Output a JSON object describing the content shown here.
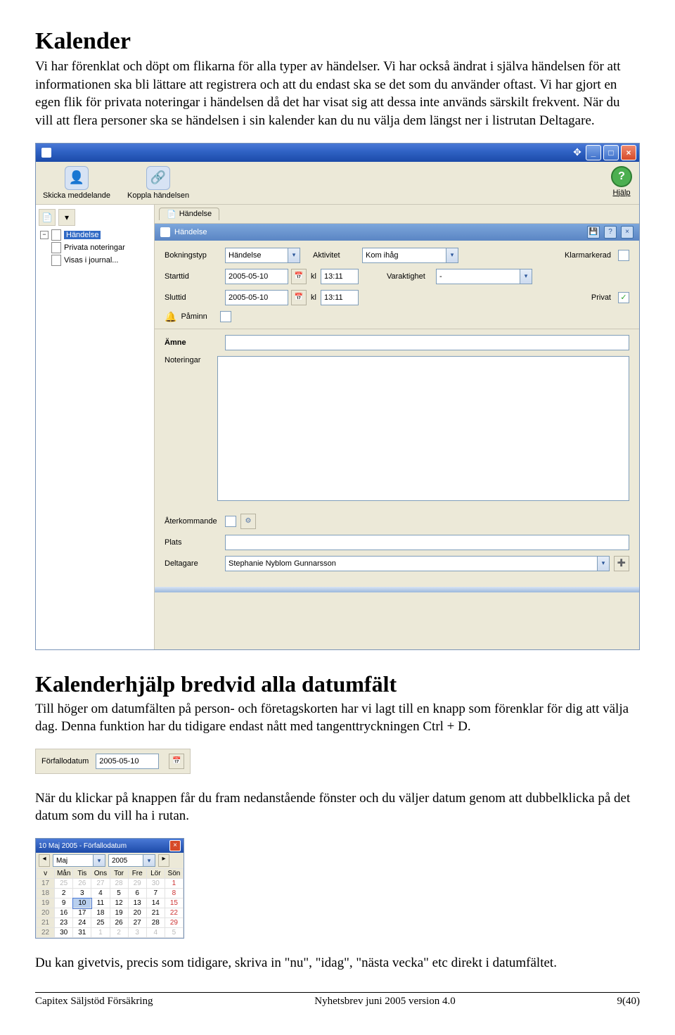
{
  "heading1": "Kalender",
  "para1": "Vi har förenklat och döpt om flikarna för alla typer av händelser. Vi har också ändrat i själva händelsen för att informationen ska bli lättare att registrera och att du endast ska se det som du använder oftast. Vi har gjort en egen flik för privata noteringar i händelsen då det har visat sig att dessa inte används särskilt frekvent. När du vill att flera personer ska se händelsen i sin kalender kan du nu välja dem längst ner i listrutan Deltagare.",
  "window": {
    "toolbar": {
      "send_msg": "Skicka meddelande",
      "link_event": "Koppla händelsen",
      "help": "Hjälp"
    },
    "tree": {
      "items": [
        "Händelse",
        "Privata noteringar",
        "Visas i journal..."
      ]
    },
    "tab": "Händelse",
    "panel_title": "Händelse",
    "form": {
      "bokningstyp_label": "Bokningstyp",
      "bokningstyp_value": "Händelse",
      "aktivitet_label": "Aktivitet",
      "aktivitet_value": "Kom ihåg",
      "klarmarkerad_label": "Klarmarkerad",
      "klarmarkerad_checked": false,
      "starttid_label": "Starttid",
      "starttid_date": "2005-05-10",
      "starttid_kl": "kl",
      "starttid_time": "13:11",
      "varaktighet_label": "Varaktighet",
      "varaktighet_value": "-",
      "sluttid_label": "Sluttid",
      "sluttid_date": "2005-05-10",
      "sluttid_kl": "kl",
      "sluttid_time": "13:11",
      "privat_label": "Privat",
      "privat_checked": true,
      "paminn_label": "Påminn",
      "paminn_checked": false,
      "amne_label": "Ämne",
      "amne_value": "",
      "noteringar_label": "Noteringar",
      "noteringar_value": "",
      "aterkommande_label": "Återkommande",
      "aterkommande_checked": false,
      "plats_label": "Plats",
      "plats_value": "",
      "deltagare_label": "Deltagare",
      "deltagare_value": "Stephanie Nyblom Gunnarsson"
    }
  },
  "heading2": "Kalenderhjälp bredvid alla datumfält",
  "para2": "Till höger om datumfälten på person- och företagskorten har vi lagt till en knapp som förenklar för dig att välja dag. Denna funktion har du tidigare endast nått med tangenttryckningen Ctrl + D.",
  "inline_form": {
    "label": "Förfallodatum",
    "value": "2005-05-10"
  },
  "para3": "När du klickar på knappen får du fram nedanstående fönster och du väljer datum genom att dubbelklicka på det datum som du vill ha i rutan.",
  "cal": {
    "title": "10 Maj 2005 - Förfallodatum",
    "month": "Maj",
    "year": "2005",
    "dow": [
      "Mån",
      "Tis",
      "Ons",
      "Tor",
      "Fre",
      "Lör",
      "Sön"
    ],
    "weeks": [
      {
        "wk": "17",
        "d": [
          "25",
          "26",
          "27",
          "28",
          "29",
          "30",
          "1"
        ],
        "other": [
          0,
          1,
          2,
          3,
          4,
          5
        ],
        "sun": 6
      },
      {
        "wk": "18",
        "d": [
          "2",
          "3",
          "4",
          "5",
          "6",
          "7",
          "8"
        ],
        "sun": 6
      },
      {
        "wk": "19",
        "d": [
          "9",
          "10",
          "11",
          "12",
          "13",
          "14",
          "15"
        ],
        "today": 1,
        "sun": 6
      },
      {
        "wk": "20",
        "d": [
          "16",
          "17",
          "18",
          "19",
          "20",
          "21",
          "22"
        ],
        "sun": 6
      },
      {
        "wk": "21",
        "d": [
          "23",
          "24",
          "25",
          "26",
          "27",
          "28",
          "29"
        ],
        "sun": 6
      },
      {
        "wk": "22",
        "d": [
          "30",
          "31",
          "1",
          "2",
          "3",
          "4",
          "5"
        ],
        "other": [
          2,
          3,
          4,
          5,
          6
        ],
        "sun": 6
      }
    ]
  },
  "para4": "Du kan givetvis, precis som tidigare, skriva in \"nu\", \"idag\", \"nästa vecka\" etc direkt i datumfältet.",
  "footer": {
    "left": "Capitex Säljstöd Försäkring",
    "mid": "Nyhetsbrev juni 2005 version 4.0",
    "right": "9(40)"
  }
}
